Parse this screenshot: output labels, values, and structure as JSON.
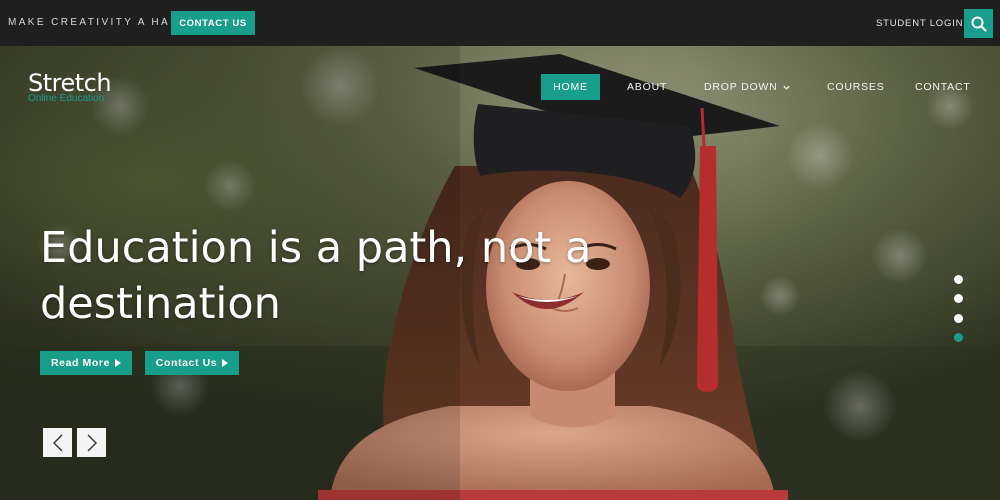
{
  "topbar": {
    "tagline": "MAKE CREATIVITY A HABIT",
    "contact_button": "CONTACT US",
    "student_login": "STUDENT LOGIN",
    "search_icon": "search-icon"
  },
  "logo": {
    "title": "Stretch",
    "subtitle": "Online Education"
  },
  "nav": {
    "items": [
      {
        "label": "HOME",
        "active": true
      },
      {
        "label": "ABOUT",
        "active": false
      },
      {
        "label": "DROP DOWN",
        "active": false,
        "icon": "chevron-down-icon"
      },
      {
        "label": "COURSES",
        "active": false
      },
      {
        "label": "CONTACT",
        "active": false
      }
    ]
  },
  "hero": {
    "headline_line1": "Education is a path, not a",
    "headline_line2": "destination",
    "read_more": "Read More",
    "contact_us": "Contact Us",
    "prev_icon": "chevron-left-icon",
    "next_icon": "chevron-right-icon",
    "slides": 4,
    "active_slide": 4
  },
  "colors": {
    "accent": "#1a9e8c",
    "topbar": "#1f1f1f"
  }
}
